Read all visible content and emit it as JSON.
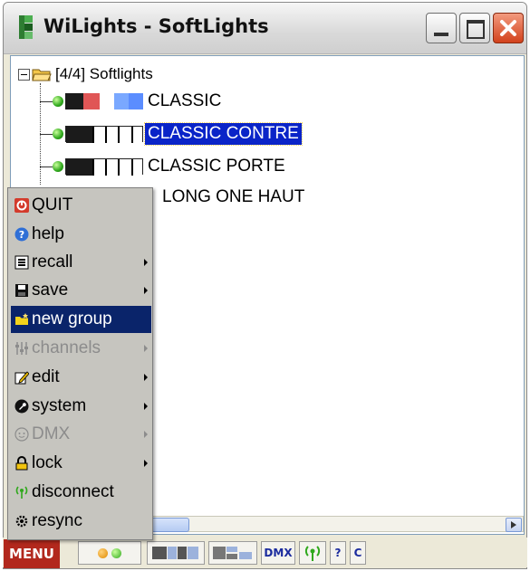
{
  "window": {
    "title": "WiLights - SoftLights",
    "minimize_icon": "minimize-icon",
    "maximize_icon": "maximize-icon",
    "close_icon": "close-icon"
  },
  "tree": {
    "root_label": "[4/4] Softlights",
    "items": [
      {
        "label": "CLASSIC",
        "selected": false,
        "has_led": true
      },
      {
        "label": "CLASSIC CONTRE",
        "selected": true,
        "has_led": true
      },
      {
        "label": "CLASSIC PORTE",
        "selected": false,
        "has_led": true
      },
      {
        "label": "LONG ONE HAUT",
        "selected": false,
        "has_led": false
      }
    ]
  },
  "menu": {
    "items": [
      {
        "label": "QUIT",
        "icon": "quit-icon",
        "enabled": true,
        "submenu": false
      },
      {
        "label": "help",
        "icon": "help-icon",
        "enabled": true,
        "submenu": false
      },
      {
        "label": "recall",
        "icon": "recall-icon",
        "enabled": true,
        "submenu": true
      },
      {
        "label": "save",
        "icon": "floppy-icon",
        "enabled": true,
        "submenu": true
      },
      {
        "label": "new group",
        "icon": "new-group-icon",
        "enabled": true,
        "submenu": false,
        "active": true
      },
      {
        "label": "channels",
        "icon": "channels-icon",
        "enabled": false,
        "submenu": true
      },
      {
        "label": "edit",
        "icon": "edit-icon",
        "enabled": true,
        "submenu": true
      },
      {
        "label": "system",
        "icon": "system-icon",
        "enabled": true,
        "submenu": true
      },
      {
        "label": "DMX",
        "icon": "dmx-icon",
        "enabled": false,
        "submenu": true
      },
      {
        "label": "lock",
        "icon": "lock-icon",
        "enabled": true,
        "submenu": true
      },
      {
        "label": "disconnect",
        "icon": "antenna-icon",
        "enabled": true,
        "submenu": false
      },
      {
        "label": "resync",
        "icon": "gear-icon",
        "enabled": true,
        "submenu": false
      }
    ]
  },
  "toolbar": {
    "menu_label": "MENU",
    "dmx_label": "DMX",
    "help_label": "?",
    "c_label": "C"
  },
  "colors": {
    "selection": "#0a24c8",
    "menu_button": "#b2281d",
    "menu_highlight": "#0a246a",
    "led_green": "#2fa81c"
  }
}
